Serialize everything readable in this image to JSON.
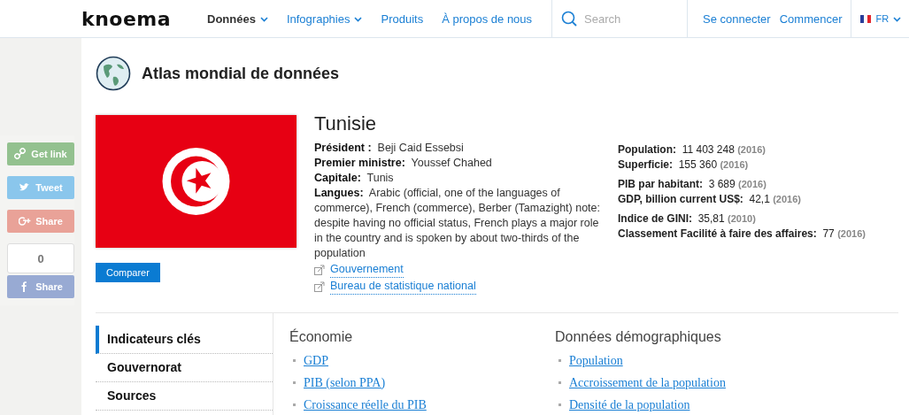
{
  "header": {
    "logo": "knoema",
    "nav": [
      {
        "label": "Données",
        "dropdown": true,
        "selected": true
      },
      {
        "label": "Infographies",
        "dropdown": true,
        "selected": false
      },
      {
        "label": "Produits",
        "dropdown": false,
        "selected": false
      },
      {
        "label": "À propos de nous",
        "dropdown": false,
        "selected": false
      }
    ],
    "search": {
      "placeholder": "Search"
    },
    "account_links": [
      "Se connecter",
      "Commencer"
    ],
    "language": "FR"
  },
  "share": [
    {
      "kind": "link",
      "label": "Get link"
    },
    {
      "kind": "twitter",
      "label": "Tweet"
    },
    {
      "kind": "gplus",
      "label": "Share"
    },
    {
      "kind": "counter",
      "label": "0"
    },
    {
      "kind": "facebook",
      "label": "Share"
    }
  ],
  "atlas_title": "Atlas mondial de données",
  "country": {
    "name": "Tunisie",
    "compare_button": "Comparer",
    "facts": [
      {
        "label": "Président :",
        "value": "Beji Caid Essebsi"
      },
      {
        "label": "Premier ministre:",
        "value": "Youssef Chahed"
      },
      {
        "label": "Capitale:",
        "value": "Tunis"
      },
      {
        "label": "Langues:",
        "value": "Arabic (official, one of the languages of commerce), French (commerce), Berber (Tamazight) note: despite having no official status, French plays a major role in the country and is spoken by about two-thirds of the population"
      }
    ],
    "links": [
      "Gouvernement",
      "Bureau de statistique national"
    ],
    "stats": [
      [
        {
          "label": "Population:",
          "value": "11 403 248",
          "year": "(2016)"
        },
        {
          "label": "Superficie:",
          "value": "155 360",
          "year": "(2016)"
        }
      ],
      [
        {
          "label": "PIB par habitant:",
          "value": "3 689",
          "year": "(2016)"
        },
        {
          "label": "GDP, billion current US$:",
          "value": "42,1",
          "year": "(2016)"
        }
      ],
      [
        {
          "label": "Indice de GINI:",
          "value": "35,81",
          "year": "(2010)"
        },
        {
          "label": "Classement Facilité à faire des affaires:",
          "value": "77",
          "year": "(2016)"
        }
      ]
    ]
  },
  "side_nav": [
    {
      "label": "Indicateurs clés",
      "selected": true
    },
    {
      "label": "Gouvernorat",
      "selected": false
    },
    {
      "label": "Sources",
      "selected": false
    }
  ],
  "categories": [
    {
      "title": "Économie",
      "items": [
        "GDP",
        "PIB (selon PPA)",
        "Croissance réelle du PIB"
      ]
    },
    {
      "title": "Données démographiques",
      "items": [
        "Population",
        "Accroissement de la population",
        "Densité de la population"
      ]
    }
  ]
}
